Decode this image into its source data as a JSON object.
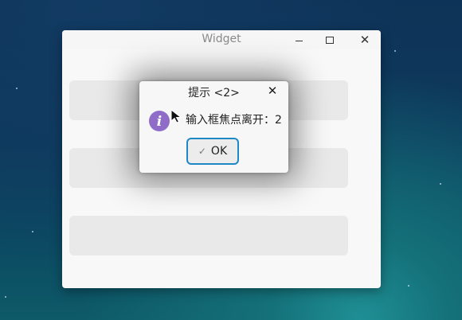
{
  "window": {
    "title": "Widget",
    "minimize_icon": "minimize-icon",
    "maximize_icon": "maximize-icon",
    "close_icon": "close-icon"
  },
  "dialog": {
    "title": "提示 <2>",
    "message": "输入框焦点离开：2",
    "ok_label": "OK",
    "close_glyph": "✕",
    "icon": "info-icon",
    "icon_color": "#8e6cc8",
    "ok_border_color": "#1e88c7"
  }
}
